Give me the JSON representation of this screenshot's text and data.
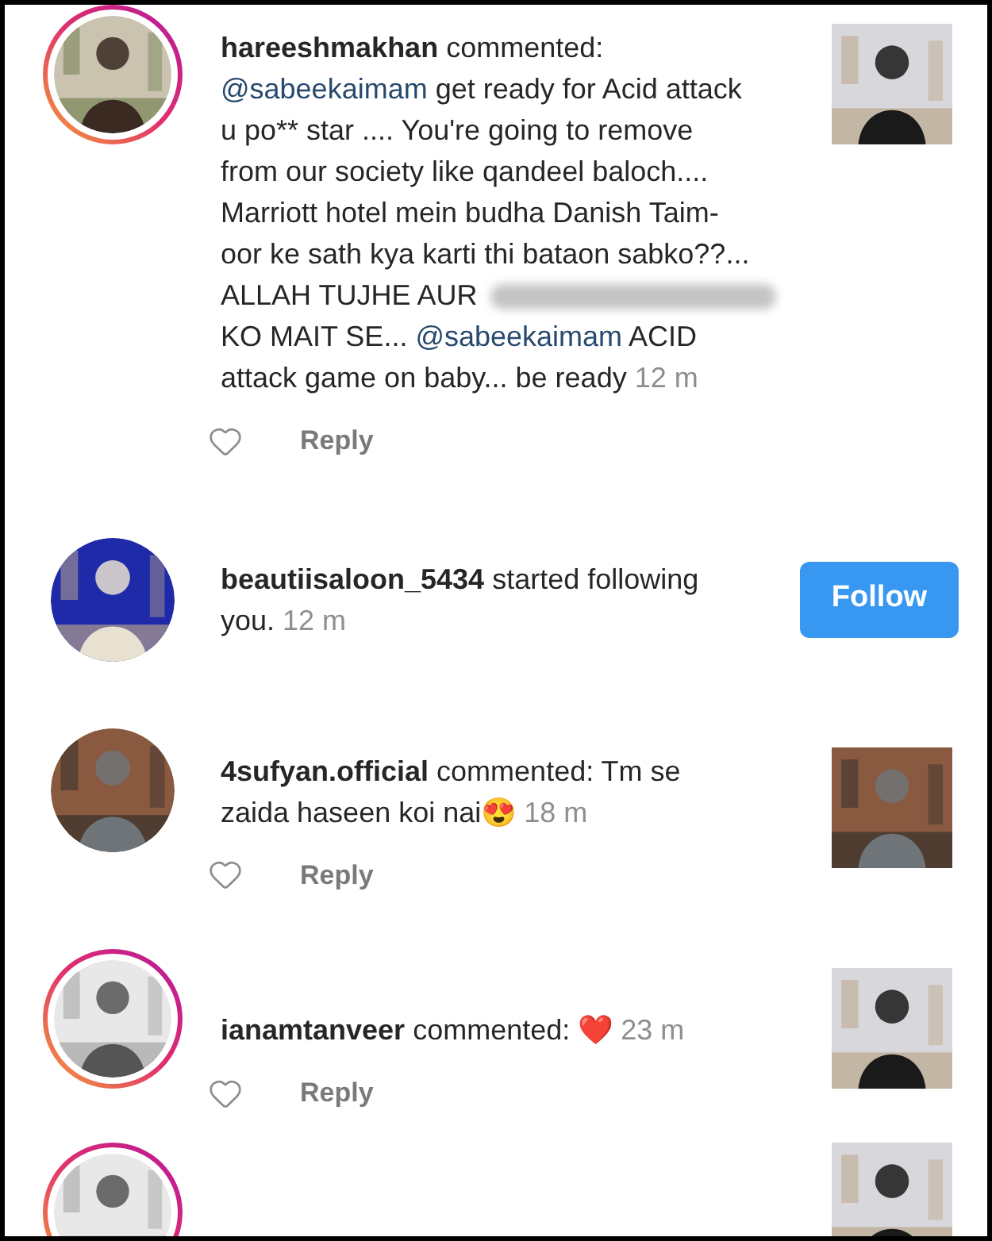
{
  "notifications": [
    {
      "kind": "comment",
      "story_ring": true,
      "username": "hareeshmakhan",
      "lines": [
        [
          {
            "kind": "text",
            "text": " commented:"
          }
        ],
        [
          {
            "kind": "mention",
            "text": "@sabeekaimam"
          },
          {
            "kind": "text",
            "text": " get ready for Acid attack"
          }
        ],
        [
          {
            "kind": "text",
            "text": "u po** star .... You're going to remove"
          }
        ],
        [
          {
            "kind": "text",
            "text": "from our society like qandeel baloch...."
          }
        ],
        [
          {
            "kind": "text",
            "text": "Marriott hotel mein budha Danish Taim-"
          }
        ],
        [
          {
            "kind": "text",
            "text": "oor ke sath kya karti thi bataon sabko??..."
          }
        ],
        [
          {
            "kind": "text",
            "text": "ALLAH TUJHE AUR"
          },
          {
            "kind": "redacted"
          }
        ],
        [
          {
            "kind": "text",
            "text": "KO MAIT SE... "
          },
          {
            "kind": "mention",
            "text": "@sabeekaimam"
          },
          {
            "kind": "text",
            "text": " ACID"
          }
        ],
        [
          {
            "kind": "text",
            "text": "attack game on baby... be ready"
          }
        ]
      ],
      "time": "12 m",
      "liked": false,
      "reply": "Reply"
    },
    {
      "kind": "follow",
      "story_ring": false,
      "username": "beautiisaloon_5434",
      "lines": [
        [
          {
            "kind": "text",
            "text": " started following"
          }
        ],
        [
          {
            "kind": "text",
            "text": "you."
          }
        ]
      ],
      "time": "12 m",
      "button": "Follow"
    },
    {
      "kind": "comment",
      "story_ring": false,
      "username": "4sufyan.official",
      "lines": [
        [
          {
            "kind": "text",
            "text": " commented: Tm se"
          }
        ],
        [
          {
            "kind": "text",
            "text": "zaida haseen koi nai😍"
          }
        ]
      ],
      "time": "18 m",
      "liked": false,
      "reply": "Reply"
    },
    {
      "kind": "comment",
      "story_ring": true,
      "username": "ianamtanveer",
      "lines": [
        [
          {
            "kind": "text",
            "text": " commented: ❤️"
          }
        ]
      ],
      "time": "23 m",
      "liked": false,
      "reply": "Reply"
    },
    {
      "kind": "partial",
      "story_ring": true
    }
  ]
}
